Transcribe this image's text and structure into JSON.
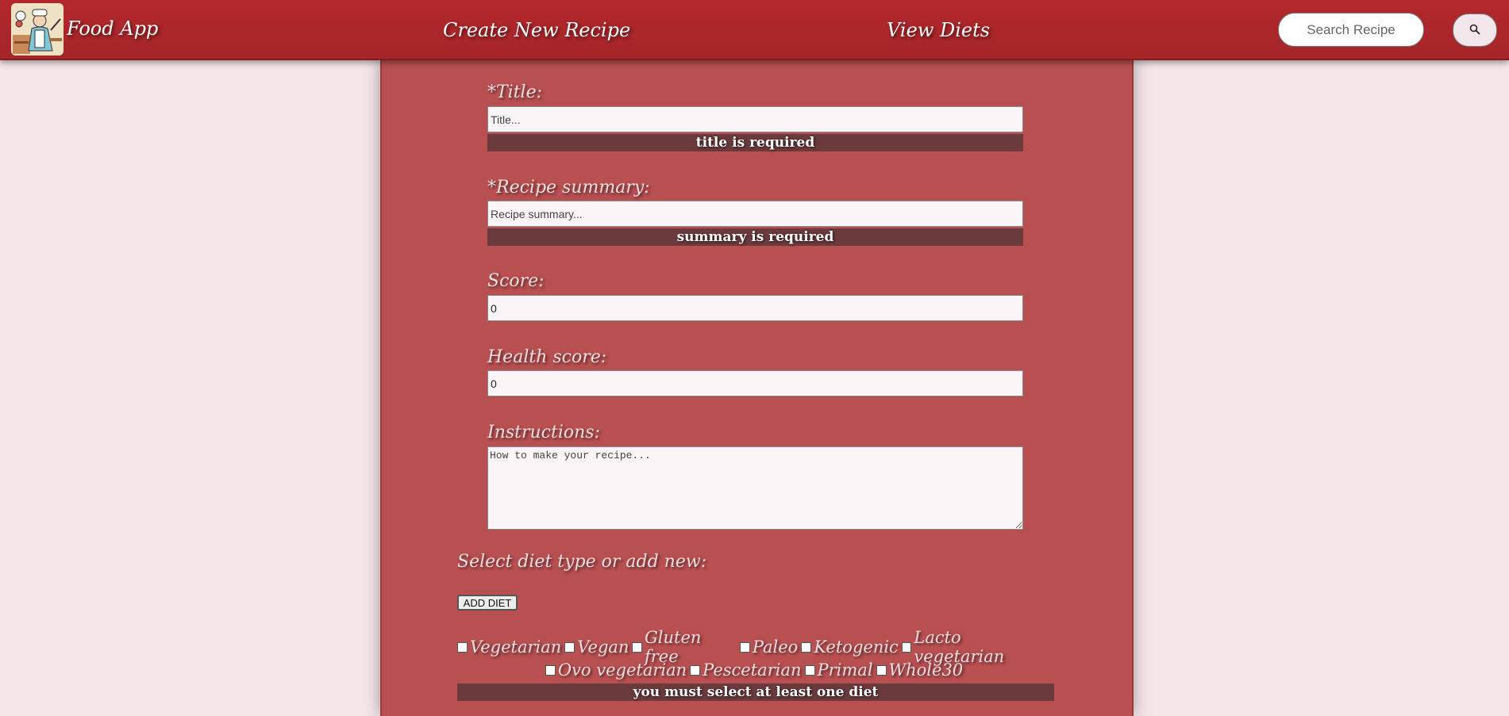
{
  "navbar": {
    "brand": "Food App",
    "links": [
      "Create New Recipe",
      "View Diets"
    ],
    "search_placeholder": "Search Recipe"
  },
  "form": {
    "title_label": "*Title:",
    "title_placeholder": "Title...",
    "title_error": "title is required",
    "summary_label": "*Recipe summary:",
    "summary_placeholder": "Recipe summary...",
    "summary_error": "summary is required",
    "score_label": "Score:",
    "score_value": "0",
    "health_label": "Health score:",
    "health_value": "0",
    "instructions_label": "Instructions:",
    "instructions_placeholder": "How to make your recipe...",
    "diet_label": "Select diet type or add new:",
    "add_diet_button": "ADD DIET",
    "diets_row1": [
      "Vegetarian",
      "Vegan",
      "Gluten free",
      "Paleo",
      "Ketogenic",
      "Lacto vegetarian"
    ],
    "diets_row2": [
      "Ovo vegetarian",
      "Pescetarian",
      "Primal",
      "Whole30"
    ],
    "diet_error": "you must select at least one diet"
  },
  "colors": {
    "navbar": "#b3272c",
    "panel": "#b84f50",
    "error_bg": "#6a3a3d",
    "page_bg": "#f5e6ea"
  },
  "icons": {
    "search": "magnifying-glass"
  }
}
